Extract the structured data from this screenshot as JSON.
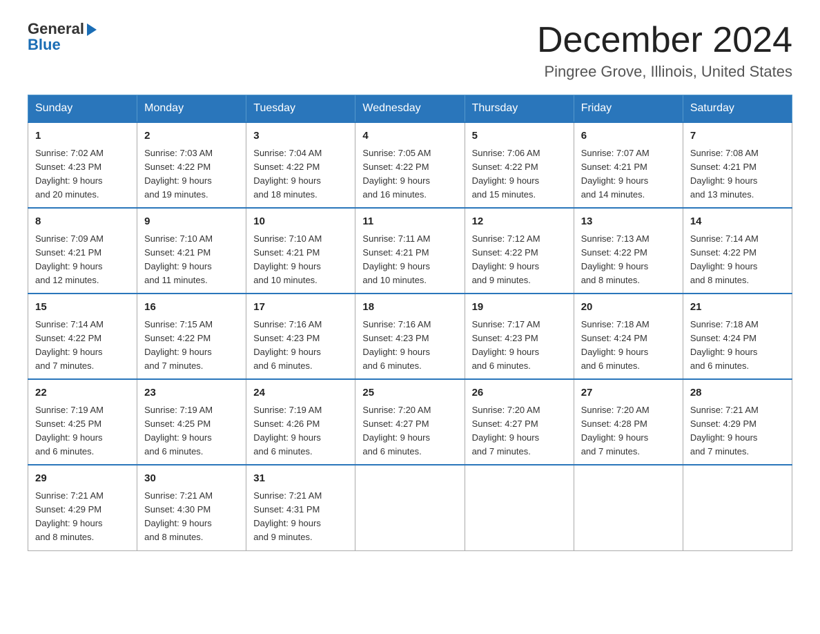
{
  "logo": {
    "line1": "General",
    "arrow": "▶",
    "line2": "Blue"
  },
  "title": "December 2024",
  "subtitle": "Pingree Grove, Illinois, United States",
  "days_of_week": [
    "Sunday",
    "Monday",
    "Tuesday",
    "Wednesday",
    "Thursday",
    "Friday",
    "Saturday"
  ],
  "weeks": [
    [
      {
        "num": "1",
        "sunrise": "7:02 AM",
        "sunset": "4:23 PM",
        "daylight": "9 hours and 20 minutes."
      },
      {
        "num": "2",
        "sunrise": "7:03 AM",
        "sunset": "4:22 PM",
        "daylight": "9 hours and 19 minutes."
      },
      {
        "num": "3",
        "sunrise": "7:04 AM",
        "sunset": "4:22 PM",
        "daylight": "9 hours and 18 minutes."
      },
      {
        "num": "4",
        "sunrise": "7:05 AM",
        "sunset": "4:22 PM",
        "daylight": "9 hours and 16 minutes."
      },
      {
        "num": "5",
        "sunrise": "7:06 AM",
        "sunset": "4:22 PM",
        "daylight": "9 hours and 15 minutes."
      },
      {
        "num": "6",
        "sunrise": "7:07 AM",
        "sunset": "4:21 PM",
        "daylight": "9 hours and 14 minutes."
      },
      {
        "num": "7",
        "sunrise": "7:08 AM",
        "sunset": "4:21 PM",
        "daylight": "9 hours and 13 minutes."
      }
    ],
    [
      {
        "num": "8",
        "sunrise": "7:09 AM",
        "sunset": "4:21 PM",
        "daylight": "9 hours and 12 minutes."
      },
      {
        "num": "9",
        "sunrise": "7:10 AM",
        "sunset": "4:21 PM",
        "daylight": "9 hours and 11 minutes."
      },
      {
        "num": "10",
        "sunrise": "7:10 AM",
        "sunset": "4:21 PM",
        "daylight": "9 hours and 10 minutes."
      },
      {
        "num": "11",
        "sunrise": "7:11 AM",
        "sunset": "4:21 PM",
        "daylight": "9 hours and 10 minutes."
      },
      {
        "num": "12",
        "sunrise": "7:12 AM",
        "sunset": "4:22 PM",
        "daylight": "9 hours and 9 minutes."
      },
      {
        "num": "13",
        "sunrise": "7:13 AM",
        "sunset": "4:22 PM",
        "daylight": "9 hours and 8 minutes."
      },
      {
        "num": "14",
        "sunrise": "7:14 AM",
        "sunset": "4:22 PM",
        "daylight": "9 hours and 8 minutes."
      }
    ],
    [
      {
        "num": "15",
        "sunrise": "7:14 AM",
        "sunset": "4:22 PM",
        "daylight": "9 hours and 7 minutes."
      },
      {
        "num": "16",
        "sunrise": "7:15 AM",
        "sunset": "4:22 PM",
        "daylight": "9 hours and 7 minutes."
      },
      {
        "num": "17",
        "sunrise": "7:16 AM",
        "sunset": "4:23 PM",
        "daylight": "9 hours and 6 minutes."
      },
      {
        "num": "18",
        "sunrise": "7:16 AM",
        "sunset": "4:23 PM",
        "daylight": "9 hours and 6 minutes."
      },
      {
        "num": "19",
        "sunrise": "7:17 AM",
        "sunset": "4:23 PM",
        "daylight": "9 hours and 6 minutes."
      },
      {
        "num": "20",
        "sunrise": "7:18 AM",
        "sunset": "4:24 PM",
        "daylight": "9 hours and 6 minutes."
      },
      {
        "num": "21",
        "sunrise": "7:18 AM",
        "sunset": "4:24 PM",
        "daylight": "9 hours and 6 minutes."
      }
    ],
    [
      {
        "num": "22",
        "sunrise": "7:19 AM",
        "sunset": "4:25 PM",
        "daylight": "9 hours and 6 minutes."
      },
      {
        "num": "23",
        "sunrise": "7:19 AM",
        "sunset": "4:25 PM",
        "daylight": "9 hours and 6 minutes."
      },
      {
        "num": "24",
        "sunrise": "7:19 AM",
        "sunset": "4:26 PM",
        "daylight": "9 hours and 6 minutes."
      },
      {
        "num": "25",
        "sunrise": "7:20 AM",
        "sunset": "4:27 PM",
        "daylight": "9 hours and 6 minutes."
      },
      {
        "num": "26",
        "sunrise": "7:20 AM",
        "sunset": "4:27 PM",
        "daylight": "9 hours and 7 minutes."
      },
      {
        "num": "27",
        "sunrise": "7:20 AM",
        "sunset": "4:28 PM",
        "daylight": "9 hours and 7 minutes."
      },
      {
        "num": "28",
        "sunrise": "7:21 AM",
        "sunset": "4:29 PM",
        "daylight": "9 hours and 7 minutes."
      }
    ],
    [
      {
        "num": "29",
        "sunrise": "7:21 AM",
        "sunset": "4:29 PM",
        "daylight": "9 hours and 8 minutes."
      },
      {
        "num": "30",
        "sunrise": "7:21 AM",
        "sunset": "4:30 PM",
        "daylight": "9 hours and 8 minutes."
      },
      {
        "num": "31",
        "sunrise": "7:21 AM",
        "sunset": "4:31 PM",
        "daylight": "9 hours and 9 minutes."
      },
      null,
      null,
      null,
      null
    ]
  ]
}
